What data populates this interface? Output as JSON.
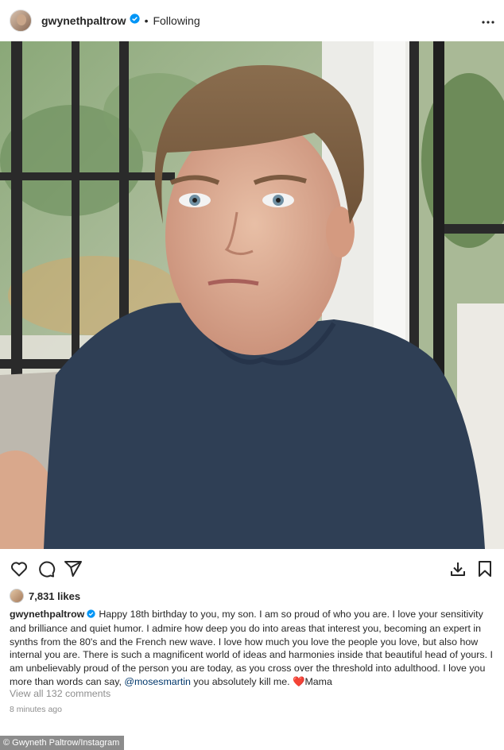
{
  "header": {
    "username": "gwynethpaltrow",
    "separator": "•",
    "follow_status": "Following",
    "more_icon": "more-horizontal-icon"
  },
  "post": {
    "image_icon": "photo"
  },
  "actions": {
    "like_icon": "heart-icon",
    "comment_icon": "comment-icon",
    "share_icon": "send-icon",
    "download_icon": "download-icon",
    "save_icon": "bookmark-icon"
  },
  "likes": {
    "count_text": "7,831 likes"
  },
  "caption": {
    "username": "gwynethpaltrow",
    "text": "Happy 18th birthday to you, my son. I am so proud of who you are. I love your sensitivity and brilliance and quiet humor. I admire how deep you do into areas that interest you, becoming an expert in synths from the 80's and the French new wave. I love how much you love the people you love, but also how internal you are. There is such a magnificent world of ideas and harmonies inside that beautiful head of yours. I am unbelievably proud of the person you are today, as you cross over the threshold into adulthood. I love you more than words can say,",
    "mention": "@mosesmartin",
    "text_after": "you absolutely kill me.",
    "emoji": "❤️",
    "signoff": "Mama"
  },
  "comments": {
    "view_all": "View all 132 comments"
  },
  "timestamp": "8 minutes ago",
  "credit": "© Gwyneth Paltrow/Instagram",
  "colors": {
    "text": "#262626",
    "muted": "#8e8e8e",
    "verified": "#0095f6",
    "mention": "#00376b",
    "heart": "#d0102c",
    "shirt": "#2f3f55"
  }
}
